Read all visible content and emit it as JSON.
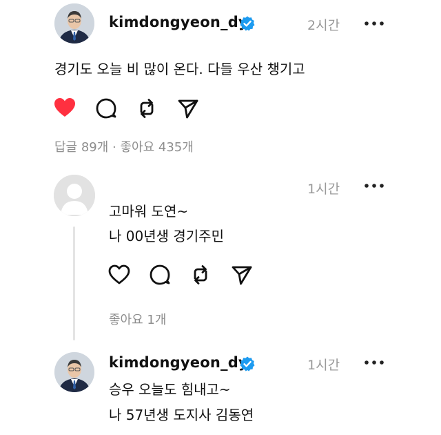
{
  "post": {
    "username": "kimdongyeon_dy",
    "time": "2시간",
    "text": "경기도 오늘 비 많이 온다. 다들 우산 챙기고",
    "liked": true,
    "stats": "답글 89개 · 좋아요 435개"
  },
  "reply1": {
    "time": "1시간",
    "lines": [
      "고마워 도연~",
      "나 00년생 경기주민"
    ],
    "stats": "좋아요 1개"
  },
  "reply2": {
    "username": "kimdongyeon_dy",
    "time": "1시간",
    "lines": [
      "승우 오늘도 힘내고~",
      "나 57년생 도지사 김동연"
    ]
  },
  "icons": {
    "like": "heart-icon",
    "comment": "comment-icon",
    "repost": "repost-icon",
    "share": "send-icon",
    "more": "more-icon",
    "verified": "verified-badge-icon"
  },
  "colors": {
    "like_red": "#ff3040",
    "verified_blue": "#1d9bf0",
    "muted": "#999999"
  }
}
